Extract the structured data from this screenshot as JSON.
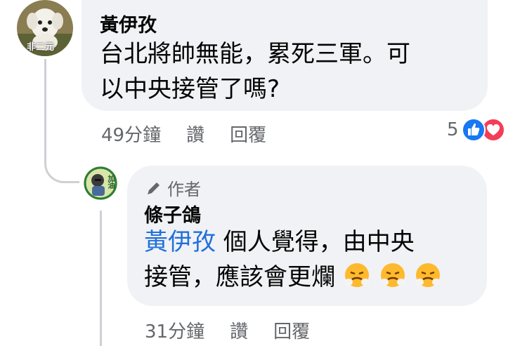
{
  "comment": {
    "author": "黃伊孜",
    "text_line1": "台北將帥無能，累死三軍。可",
    "text_line2": "以中央接管了嗎?",
    "time": "49分鐘",
    "like_label": "讚",
    "reply_label": "回覆",
    "reaction_count": "5",
    "reaction_icons": [
      "like-icon",
      "love-icon"
    ],
    "avatar_caption": "非二元"
  },
  "reply": {
    "badge_label": "作者",
    "author": "條子鴿",
    "mention": "黃伊孜",
    "text_line1_rest": " 個人覺得，由中央",
    "text_line2": "接管，應該會更爛",
    "emojis": [
      "steam-face-emoji",
      "steam-face-emoji",
      "steam-face-emoji"
    ],
    "time": "31分鐘",
    "like_label": "讚",
    "reply_label": "回覆",
    "avatar_caption": "加油"
  },
  "colors": {
    "bubble_bg": "#f0f2f5",
    "mention": "#216fdb",
    "meta_text": "#65676b",
    "like_blue": "#1877f2",
    "love_red": "#f33e58"
  }
}
